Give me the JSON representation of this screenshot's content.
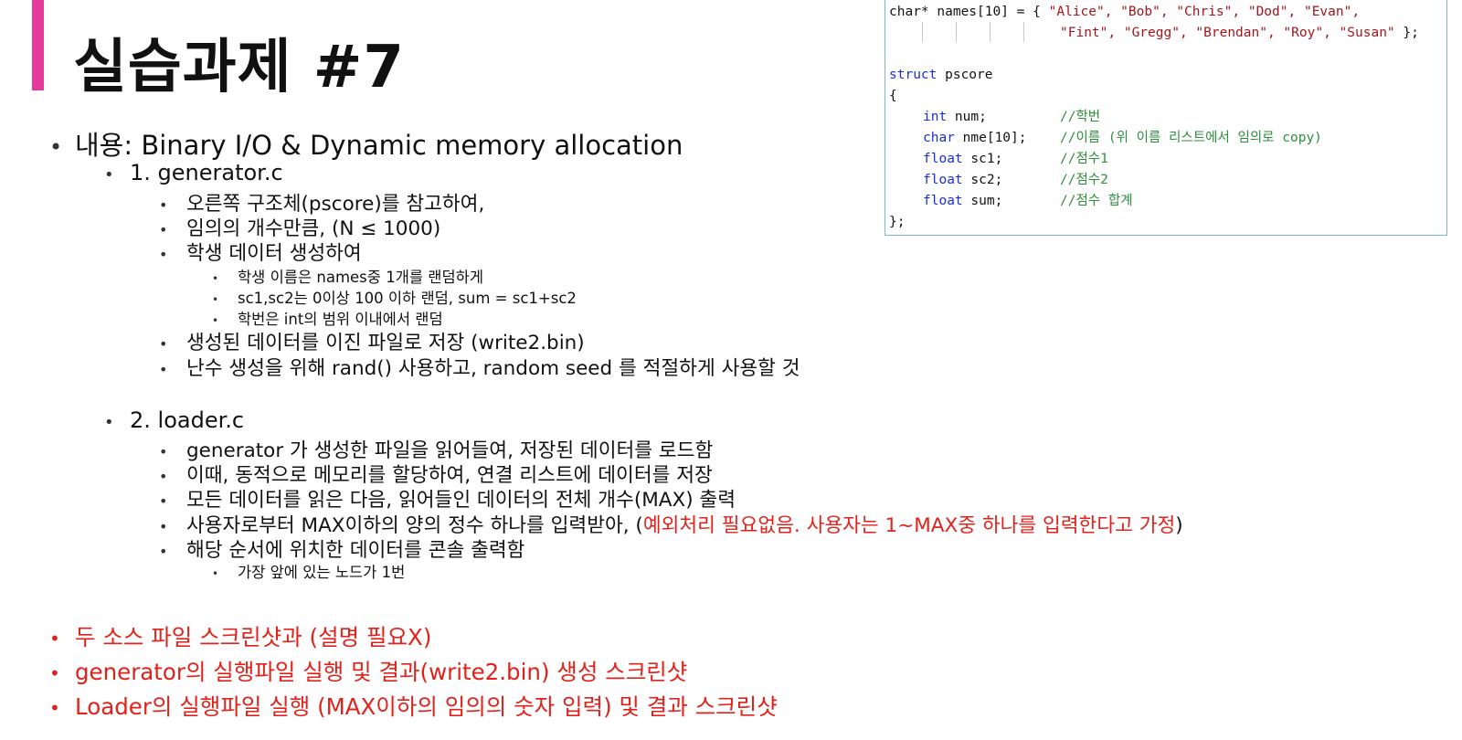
{
  "slide": {
    "title": "실습과제 #7",
    "accent_color": "#e6399b",
    "content_label": "내용: Binary I/O & Dynamic memory allocation",
    "sections": [
      {
        "heading": "1. generator.c",
        "items": [
          {
            "text": "오른쪽 구조체(pscore)를 참고하여,"
          },
          {
            "text": "임의의 개수만큼, (N ≤ 1000)"
          },
          {
            "text": "학생 데이터 생성하여",
            "sub": [
              "학생 이름은 names중 1개를 랜덤하게",
              "sc1,sc2는 0이상 100 이하 랜덤, sum = sc1+sc2",
              "학번은 int의 범위 이내에서 랜덤"
            ]
          },
          {
            "text": "생성된 데이터를 이진 파일로 저장 (write2.bin)"
          },
          {
            "text": "난수 생성을 위해 rand() 사용하고, random seed 를 적절하게 사용할 것"
          }
        ]
      },
      {
        "heading": "2. loader.c",
        "items": [
          {
            "text": "generator 가 생성한 파일을 읽어들여, 저장된 데이터를 로드함"
          },
          {
            "text": "이때, 동적으로 메모리를 할당하여, 연결 리스트에 데이터를 저장"
          },
          {
            "text": "모든 데이터를 읽은 다음, 읽어들인 데이터의 전체 개수(MAX) 출력"
          },
          {
            "text": "사용자로부터 MAX이하의 양의 정수 하나를 입력받아, (",
            "red": "예외처리 필요없음. 사용자는  1~MAX중 하나를 입력한다고 가정",
            "tail": ")"
          },
          {
            "text": "해당 순서에 위치한 데이터를 콘솔 출력함",
            "sub": [
              "가장 앞에 있는 노드가 1번"
            ]
          }
        ]
      }
    ],
    "requirements": [
      "두 소스 파일 스크린샷과 (설명 필요X)",
      "generator의 실행파일 실행 및 결과(write2.bin) 생성 스크린샷",
      "Loader의 실행파일 실행 (MAX이하의 임의의 숫자 입력) 및 결과 스크린샷"
    ],
    "bullet_glyph": "•"
  },
  "code": {
    "names_prefix": "char* names[10] = { ",
    "names_row1": "\"Alice\", \"Bob\", \"Chris\", \"Dod\", \"Evan\",",
    "names_row2": "\"Fint\", \"Gregg\", \"Brendan\", \"Roy\", \"Susan\"",
    "names_end": " };",
    "struct_kw": "struct",
    "struct_name": " pscore",
    "open_brace": "{",
    "fields": [
      {
        "type": "int",
        "decl": " num;",
        "comment": "//학번"
      },
      {
        "type": "char",
        "decl": " nme[10];",
        "comment": "//이름 (위 이름 리스트에서 임의로 copy)"
      },
      {
        "type": "float",
        "decl": " sc1;",
        "comment": "//점수1"
      },
      {
        "type": "float",
        "decl": " sc2;",
        "comment": "//점수2"
      },
      {
        "type": "float",
        "decl": " sum;",
        "comment": "//점수 합계"
      }
    ],
    "close_brace": "};"
  }
}
